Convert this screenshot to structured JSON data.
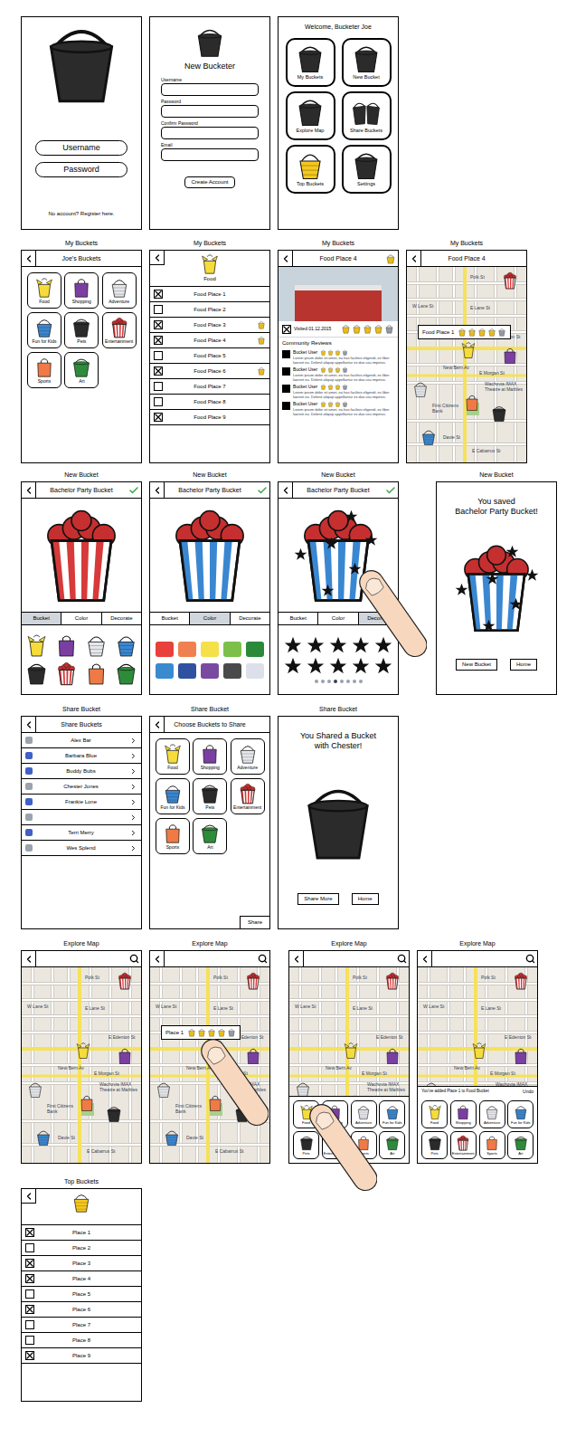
{
  "buckets": [
    {
      "label": "Food",
      "color": "#f6dc3a",
      "kind": "box"
    },
    {
      "label": "Shopping",
      "color": "#7b3fa2",
      "kind": "bag"
    },
    {
      "label": "Adventure",
      "color": "#e5e7eb",
      "kind": "basket"
    },
    {
      "label": "Fun for Kids",
      "color": "#3a87d1",
      "kind": "basket"
    },
    {
      "label": "Pets",
      "color": "#2b2b2b",
      "kind": "pail"
    },
    {
      "label": "Entertainment",
      "color": "#d63a3a",
      "kind": "popcorn"
    },
    {
      "label": "Sports",
      "color": "#ef7a45",
      "kind": "bag"
    },
    {
      "label": "Art",
      "color": "#2e8b3a",
      "kind": "pail"
    }
  ],
  "map": {
    "labels": [
      "Polk St",
      "W Lane St",
      "E Lane St",
      "E Edenton St",
      "New Bern Av",
      "E Morgan St",
      "Wachovia IMAX Theatre at Marbles",
      "First Citizens Bank",
      "Davie St",
      "E Cabarrus St"
    ],
    "pins": [
      {
        "color": "#d63a3a",
        "kind": "popcorn"
      },
      {
        "color": "#f6dc3a",
        "kind": "box"
      },
      {
        "color": "#7b3fa2",
        "kind": "bag"
      },
      {
        "color": "#e5e7eb",
        "kind": "basket"
      },
      {
        "color": "#ef7a45",
        "kind": "bag"
      },
      {
        "color": "#2b2b2b",
        "kind": "pail"
      },
      {
        "color": "#3a87d1",
        "kind": "basket"
      }
    ]
  },
  "rows": [
    {
      "screens": [
        {
          "kind": "login",
          "username": "Username",
          "password": "Password",
          "register": "No account? Register here."
        },
        {
          "kind": "signup",
          "title": "New Bucketer",
          "fields": [
            "Username",
            "Password",
            "Confirm Password",
            "Email"
          ],
          "button": "Create Account"
        },
        {
          "kind": "home",
          "welcome": "Welcome, Bucketer Joe",
          "tiles": [
            {
              "label": "My Buckets",
              "color": "#2b2b2b",
              "kind": "pail"
            },
            {
              "label": "New Bucket",
              "color": "#2b2b2b",
              "kind": "pail"
            },
            {
              "label": "Explore Map",
              "color": "#2b2b2b",
              "kind": "pail"
            },
            {
              "label": "Share Buckets",
              "color": "#2b2b2b",
              "kind": "pair"
            },
            {
              "label": "Top Buckets",
              "color": "#f6c81e",
              "kind": "basket"
            },
            {
              "label": "Settings",
              "color": "#2b2b2b",
              "kind": "pail"
            }
          ]
        }
      ]
    },
    {
      "screens": [
        {
          "kind": "grid",
          "caption": "My Buckets",
          "title": "Joe's Buckets"
        },
        {
          "kind": "list",
          "caption": "My Buckets",
          "title": "Food",
          "icon": {
            "color": "#f6dc3a",
            "kind": "box"
          },
          "items": [
            {
              "label": "Food Place 1",
              "checked": true,
              "top": false
            },
            {
              "label": "Food Place 2",
              "checked": false,
              "top": false
            },
            {
              "label": "Food Place 3",
              "checked": true,
              "top": true
            },
            {
              "label": "Food Place 4",
              "checked": true,
              "top": true
            },
            {
              "label": "Food Place 5",
              "checked": false,
              "top": false
            },
            {
              "label": "Food Place 6",
              "checked": true,
              "top": true
            },
            {
              "label": "Food Place 7",
              "checked": false,
              "top": false
            },
            {
              "label": "Food Place 8",
              "checked": false,
              "top": false
            },
            {
              "label": "Food Place 9",
              "checked": true,
              "top": false
            }
          ]
        },
        {
          "kind": "detail",
          "caption": "My Buckets",
          "title": "Food Place 4",
          "top": true,
          "visited": {
            "checked": true,
            "label": "Visited 01.12.2015"
          },
          "rating": 4,
          "rating_max": 5,
          "reviews_title": "Community Reviews",
          "reviews": [
            {
              "user": "Bucket User",
              "rating": 3,
              "rating_max": 4,
              "text": "Lorem ipsum dolor sit amet, ea has facilisis eligendi, ex liber laoreet ea. Delenit aliquip appellantur ex duo usu impetus."
            },
            {
              "user": "Bucket User",
              "rating": 3,
              "rating_max": 4,
              "text": "Lorem ipsum dolor sit amet, ea has facilisis eligendi, ex liber laoreet ea. Delenit aliquip appellantur ex duo usu impetus."
            },
            {
              "user": "Bucket User",
              "rating": 3,
              "rating_max": 4,
              "text": "Lorem ipsum dolor sit amet, ea has facilisis eligendi, ex liber laoreet ea. Delenit aliquip appellantur ex duo usu impetus."
            },
            {
              "user": "Bucket User",
              "rating": 3,
              "rating_max": 4,
              "text": "Lorem ipsum dolor sit amet, ea has facilisis eligendi, ex liber laoreet ea. Delenit aliquip appellantur ex duo usu impetus."
            }
          ]
        },
        {
          "kind": "map",
          "caption": "My Buckets",
          "title": "Food Place 4",
          "search": false,
          "popup": {
            "label": "Food Place 1",
            "rating": 4,
            "rating_max": 5
          },
          "finger": false,
          "grid": false,
          "toast": null
        }
      ]
    },
    {
      "screens": [
        {
          "kind": "designer",
          "caption": "New Bucket",
          "title": "Bachelor Party Bucket",
          "color": "#d63a3a",
          "decorated": false,
          "finger": false,
          "tabs": [
            {
              "label": "Bucket",
              "selected": true
            },
            {
              "label": "Color",
              "selected": false
            },
            {
              "label": "Decorate",
              "selected": false
            }
          ]
        },
        {
          "kind": "designer",
          "caption": "New Bucket",
          "title": "Bachelor Party Bucket",
          "color": "#3a87d1",
          "decorated": false,
          "finger": false,
          "tabs": [
            {
              "label": "Bucket",
              "selected": false
            },
            {
              "label": "Color",
              "selected": true
            },
            {
              "label": "Decorate",
              "selected": false
            }
          ],
          "swatches": [
            {
              "color": "#e8403a"
            },
            {
              "color": "#f08050"
            },
            {
              "color": "#f5e04a"
            },
            {
              "color": "#7cc04a"
            },
            {
              "color": "#2a8a3a"
            },
            {
              "color": "#3a8ad0"
            },
            {
              "color": "#3050a0"
            },
            {
              "color": "#7a4aa0"
            },
            {
              "color": "#4a4a4a"
            },
            {
              "color": "#dde0ea"
            }
          ]
        },
        {
          "kind": "designer",
          "caption": "New Bucket",
          "title": "Bachelor Party Bucket",
          "color": "#3a87d1",
          "decorated": true,
          "finger": true,
          "tabs": [
            {
              "label": "Bucket",
              "selected": false
            },
            {
              "label": "Color",
              "selected": false
            },
            {
              "label": "Decorate",
              "selected": true
            }
          ],
          "stickers": [
            {
              "shape": "star"
            },
            {
              "shape": "star"
            },
            {
              "shape": "star"
            },
            {
              "shape": "star"
            },
            {
              "shape": "star"
            },
            {
              "shape": "star"
            },
            {
              "shape": "star"
            },
            {
              "shape": "star"
            },
            {
              "shape": "star"
            },
            {
              "shape": "star"
            }
          ],
          "pages": [
            {
              "selected": false
            },
            {
              "selected": false
            },
            {
              "selected": false
            },
            {
              "selected": true
            },
            {
              "selected": false
            },
            {
              "selected": false
            },
            {
              "selected": false
            },
            {
              "selected": false
            }
          ]
        },
        {
          "kind": "saved",
          "caption": "New Bucket",
          "lines": [
            "You saved",
            "Bachelor Party Bucket!"
          ],
          "color": "#3a87d1",
          "decorated": true,
          "buttons": [
            "New Bucket",
            "Home"
          ]
        }
      ]
    },
    {
      "screens": [
        {
          "kind": "contacts",
          "caption": "Share Bucket",
          "title": "Share Buckets",
          "contacts": [
            {
              "name": "Alex Bar",
              "color": "#9ca3af"
            },
            {
              "name": "Barbara Blue",
              "color": "#4060c8"
            },
            {
              "name": "Buddy Bubs",
              "color": "#4060c8"
            },
            {
              "name": "Chester Jones",
              "color": "#9ca3af"
            },
            {
              "name": "Frankie Lone",
              "color": "#4060c8"
            },
            {
              "name": "",
              "color": "#9ca3af"
            },
            {
              "name": "Terri Merry",
              "color": "#4060c8"
            },
            {
              "name": "Wes Splend",
              "color": "#9ca3af"
            }
          ]
        },
        {
          "kind": "choose",
          "caption": "Share Bucket",
          "title": "Choose Buckets to Share",
          "button": "Share"
        },
        {
          "kind": "shared",
          "caption": "Share Bucket",
          "lines": [
            "You Shared a Bucket",
            "with Chester!"
          ],
          "buttons": [
            "Share More",
            "Home"
          ]
        }
      ]
    },
    {
      "screens": [
        {
          "kind": "map",
          "caption": "Explore Map",
          "title": "",
          "search": true,
          "popup": null,
          "finger": false,
          "grid": false,
          "toast": null
        },
        {
          "kind": "map",
          "caption": "Explore Map",
          "title": "",
          "search": true,
          "popup": {
            "label": "Place 1",
            "rating": 4,
            "rating_max": 5
          },
          "finger": true,
          "grid": false,
          "toast": null
        },
        {
          "kind": "map",
          "caption": "Explore Map",
          "title": "",
          "search": true,
          "popup": null,
          "finger": true,
          "grid": true,
          "toast": null
        },
        {
          "kind": "map",
          "caption": "Explore Map",
          "title": "",
          "search": true,
          "popup": null,
          "finger": false,
          "grid": true,
          "toast": {
            "text": "You've added Place 1 to Food Bucket",
            "action": "Undo"
          }
        }
      ]
    },
    {
      "screens": [
        {
          "kind": "list",
          "caption": "Top Buckets",
          "title": "",
          "icon": {
            "color": "#f6c81e",
            "kind": "basket"
          },
          "items": [
            {
              "label": "Place 1",
              "checked": true,
              "top": false
            },
            {
              "label": "Place 2",
              "checked": false,
              "top": false
            },
            {
              "label": "Place 3",
              "checked": true,
              "top": false
            },
            {
              "label": "Place 4",
              "checked": true,
              "top": false
            },
            {
              "label": "Place 5",
              "checked": false,
              "top": false
            },
            {
              "label": "Place 6",
              "checked": true,
              "top": false
            },
            {
              "label": "Place 7",
              "checked": false,
              "top": false
            },
            {
              "label": "Place 8",
              "checked": false,
              "top": false
            },
            {
              "label": "Place 9",
              "checked": true,
              "top": false
            }
          ]
        }
      ]
    }
  ]
}
